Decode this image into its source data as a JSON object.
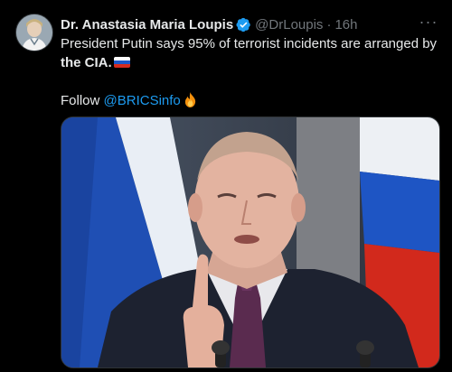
{
  "tweet": {
    "author_name": "Dr. Anastasia Maria Loupis",
    "handle": "@DrLoupis",
    "separator": "·",
    "time": "16h",
    "more_label": "···",
    "text_part1": "President Putin says 95% of terrorist incidents are arranged by ",
    "text_bold": "the CIA.",
    "follow_label": "Follow ",
    "mention": "@BRICSinfo"
  },
  "icons": {
    "verified": "verified-badge-icon",
    "flag": "russian-flag-emoji",
    "fire": "fire-emoji",
    "more": "more-options-icon"
  },
  "colors": {
    "background": "#000000",
    "text": "#e7e9ea",
    "secondary": "#71767b",
    "link": "#1d9bf0"
  }
}
